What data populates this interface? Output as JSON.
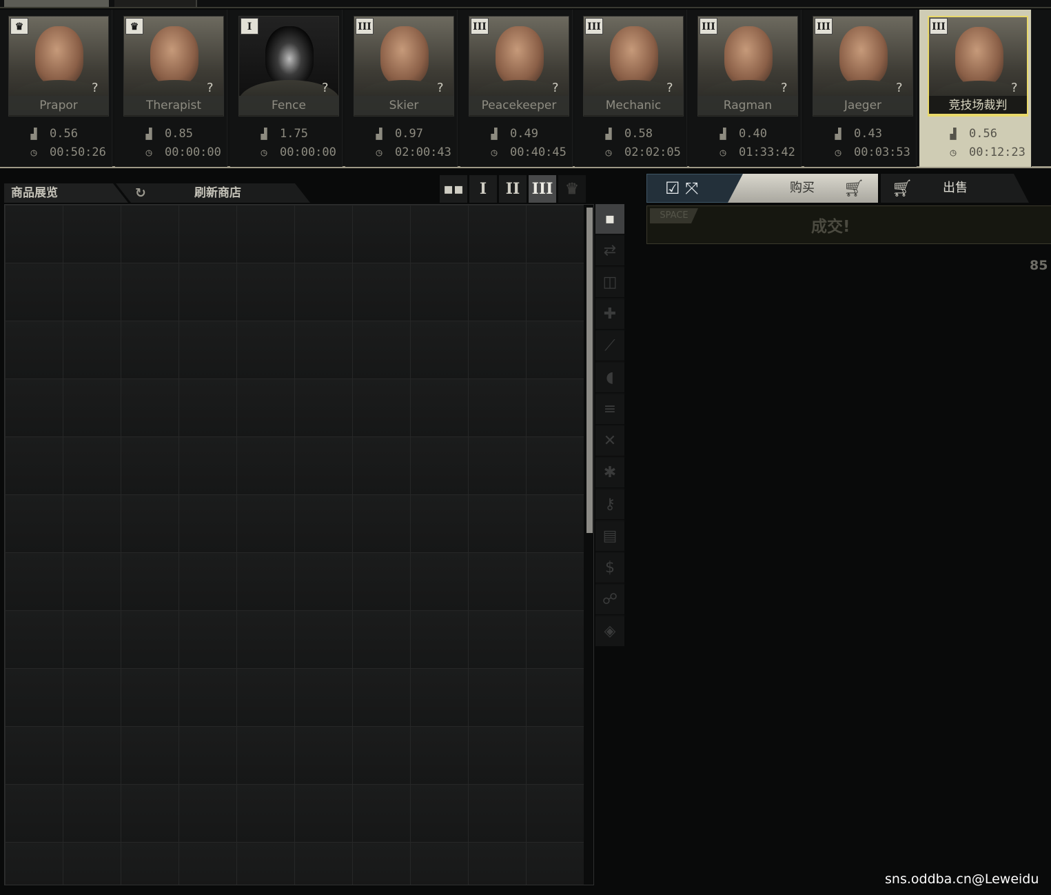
{
  "traders": [
    {
      "name": "Prapor",
      "level": "♛",
      "reputation": "0.56",
      "timer": "00:50:26"
    },
    {
      "name": "Therapist",
      "level": "♛",
      "reputation": "0.85",
      "timer": "00:00:00"
    },
    {
      "name": "Fence",
      "level": "I",
      "reputation": "1.75",
      "timer": "00:00:00"
    },
    {
      "name": "Skier",
      "level": "III",
      "reputation": "0.97",
      "timer": "02:00:43"
    },
    {
      "name": "Peacekeeper",
      "level": "III",
      "reputation": "0.49",
      "timer": "00:40:45"
    },
    {
      "name": "Mechanic",
      "level": "III",
      "reputation": "0.58",
      "timer": "02:02:05"
    },
    {
      "name": "Ragman",
      "level": "III",
      "reputation": "0.40",
      "timer": "01:33:42"
    },
    {
      "name": "Jaeger",
      "level": "III",
      "reputation": "0.43",
      "timer": "00:03:53"
    },
    {
      "name": "竞技场裁判",
      "level": "III",
      "reputation": "0.56",
      "timer": "00:12:23"
    }
  ],
  "question_mark": "?",
  "left_panel": {
    "goods_tab": "商品展览",
    "refresh_tab": "刷新商店",
    "view_buttons": [
      "I",
      "II",
      "III"
    ]
  },
  "deal": {
    "buy_label": "购买",
    "sell_label": "出售",
    "space_key": "SPACE",
    "deal_label": "成交!",
    "cutoff_value": "85"
  },
  "watermark": "sns.oddba.cn@Leweidu",
  "colors": {
    "selected_card": "#cfccb4",
    "selected_border": "#e9d96a",
    "buy_tab": "#d9d7cd"
  }
}
